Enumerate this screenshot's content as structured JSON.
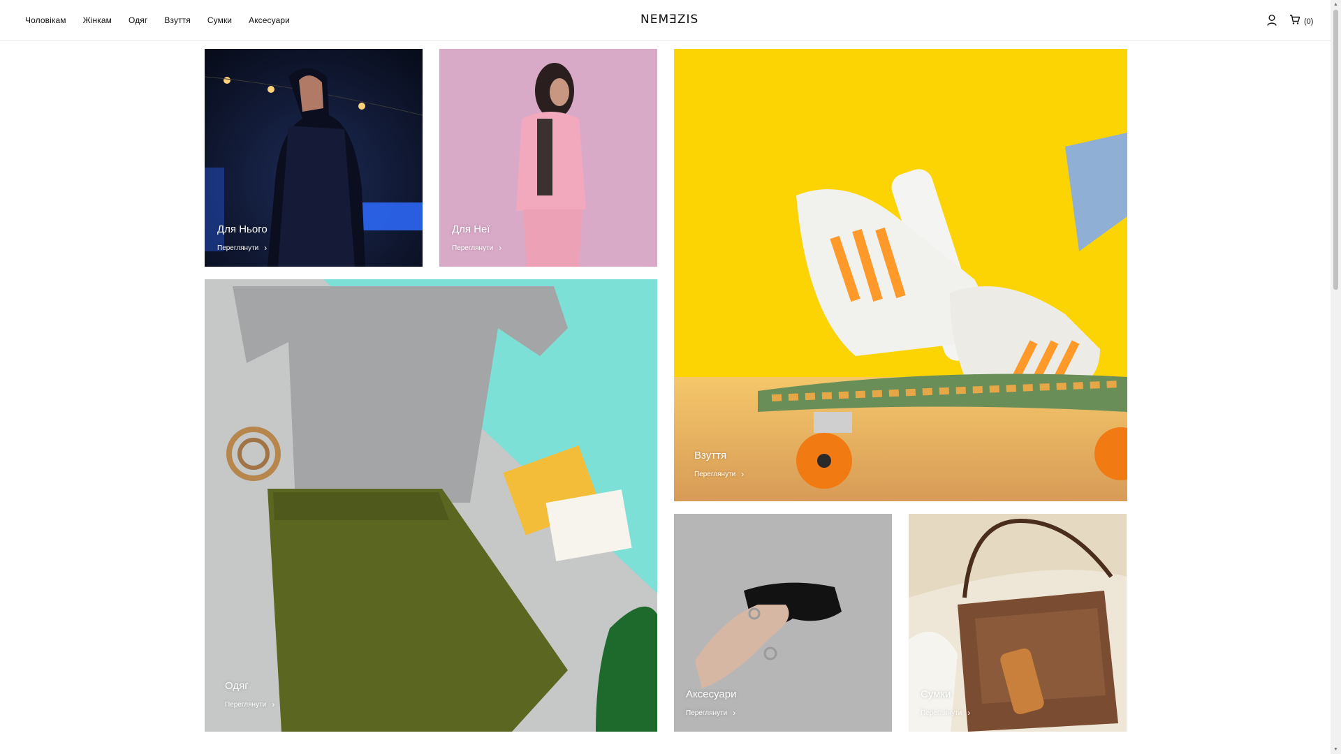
{
  "header": {
    "nav": [
      "Чоловікам",
      "Жінкам",
      "Одяг",
      "Взуття",
      "Сумки",
      "Аксесуари"
    ],
    "logo": "NEMƎZIS",
    "cart_count": "(0)"
  },
  "tiles": {
    "men": {
      "title": "Для Нього",
      "link": "Переглянути"
    },
    "women": {
      "title": "Для Неї",
      "link": "Переглянути"
    },
    "shoes": {
      "title": "Взуття",
      "link": "Переглянути"
    },
    "clothes": {
      "title": "Одяг",
      "link": "Переглянути"
    },
    "accessories": {
      "title": "Аксесуари",
      "link": "Переглянути"
    },
    "bags": {
      "title": "Сумки",
      "link": "Переглянути"
    }
  },
  "icons": {
    "user": "user-icon",
    "cart": "cart-icon",
    "chevron": "chevron-right-icon"
  },
  "colors": {
    "text": "#111111",
    "caption": "#ffffff",
    "shoes_bg": "#fbd402",
    "women_bg": "#dbaec9",
    "clothes_mint": "#78ddd3"
  }
}
